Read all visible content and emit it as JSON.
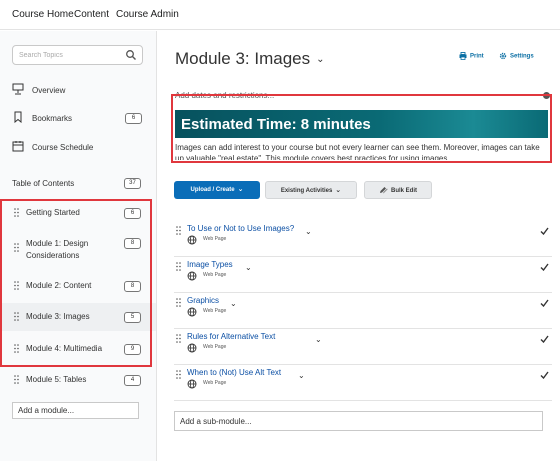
{
  "topnav": {
    "course_home": "Course Home",
    "content": "Content",
    "course_admin": "Course Admin"
  },
  "sidebar": {
    "search_placeholder": "Search Topics",
    "items": [
      {
        "label": "Overview",
        "icon": "overview-icon"
      },
      {
        "label": "Bookmarks",
        "icon": "bookmark-icon",
        "count": "6"
      },
      {
        "label": "Course Schedule",
        "icon": "calendar-icon"
      }
    ],
    "toc_label": "Table of Contents",
    "toc_count": "37",
    "modules": [
      {
        "label": "Getting Started",
        "count": "6"
      },
      {
        "label": "Module 1: Design Considerations",
        "count": "8"
      },
      {
        "label": "Module 2: Content",
        "count": "8"
      },
      {
        "label": "Module 3: Images",
        "count": "5"
      },
      {
        "label": "Module 4: Multimedia",
        "count": "9"
      },
      {
        "label": "Module 5: Tables",
        "count": "4"
      }
    ],
    "add_module": "Add a module..."
  },
  "main": {
    "title": "Module 3: Images",
    "print": "Print",
    "settings": "Settings",
    "add_dates": "Add dates and restrictions...",
    "banner_text": "Estimated Time: 8 minutes",
    "description": "Images can add interest to your course but not every learner can see them. Moreover, images can take up valuable \"real estate\". This module covers best practices for using images.",
    "buttons": {
      "upload": "Upload / Create",
      "existing": "Existing Activities",
      "bulk_edit": "Bulk Edit"
    },
    "topics": [
      {
        "title": "To Use or Not to Use Images?",
        "type": "Web Page"
      },
      {
        "title": "Image Types",
        "type": "Web Page"
      },
      {
        "title": "Graphics",
        "type": "Web Page"
      },
      {
        "title": "Rules for Alternative Text",
        "type": "Web Page"
      },
      {
        "title": "When to (Not) Use Alt Text",
        "type": "Web Page"
      }
    ],
    "add_submodule": "Add a sub-module..."
  },
  "colors": {
    "highlight": "#e0373d",
    "primary": "#0a6db8",
    "banner": "#07525e",
    "link": "#0b4fa4"
  }
}
